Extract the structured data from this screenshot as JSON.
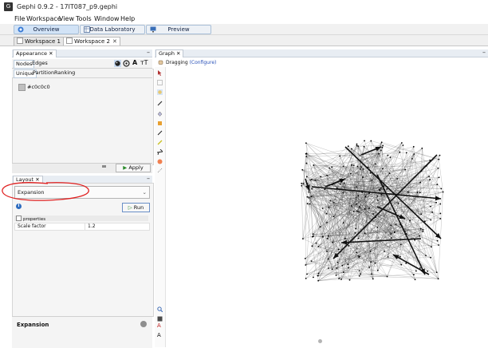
{
  "window": {
    "title": "Gephi 0.9.2 - 17IT087_p9.gephi",
    "logo_icon": "gephi-logo-icon"
  },
  "menu": [
    "File",
    "Workspace",
    "View",
    "Tools",
    "Window",
    "Help"
  ],
  "modes": [
    {
      "label": "Overview",
      "icon": "overview-icon",
      "active": true
    },
    {
      "label": "Data Laboratory",
      "icon": "table-icon",
      "active": false
    },
    {
      "label": "Preview",
      "icon": "monitor-icon",
      "active": false
    }
  ],
  "workspace_tabs": [
    {
      "label": "Workspace 1",
      "active": false
    },
    {
      "label": "Workspace 2",
      "active": true
    }
  ],
  "appearance": {
    "panel_title": "Appearance",
    "element_tabs": [
      "Nodes",
      "Edges"
    ],
    "mode_tabs": [
      "Unique",
      "Partition",
      "Ranking"
    ],
    "color_label": "#c0c0c0",
    "swatch_color": "#c0c0c0",
    "apply_label": "Apply",
    "tool_icons": [
      "palette-icon",
      "size-icon",
      "label-color-icon",
      "label-size-icon"
    ]
  },
  "layout": {
    "panel_title": "Layout",
    "selected_layout": "Expansion",
    "run_label": "Run",
    "properties_header": "properties",
    "property_rows": [
      {
        "key": "Scale factor",
        "value": "1.2"
      }
    ],
    "description_title": "Expansion"
  },
  "graph": {
    "panel_title": "Graph",
    "mode_text": "Dragging",
    "configure_text": "(Configure)"
  },
  "annotation": {
    "color": "#e02020"
  }
}
